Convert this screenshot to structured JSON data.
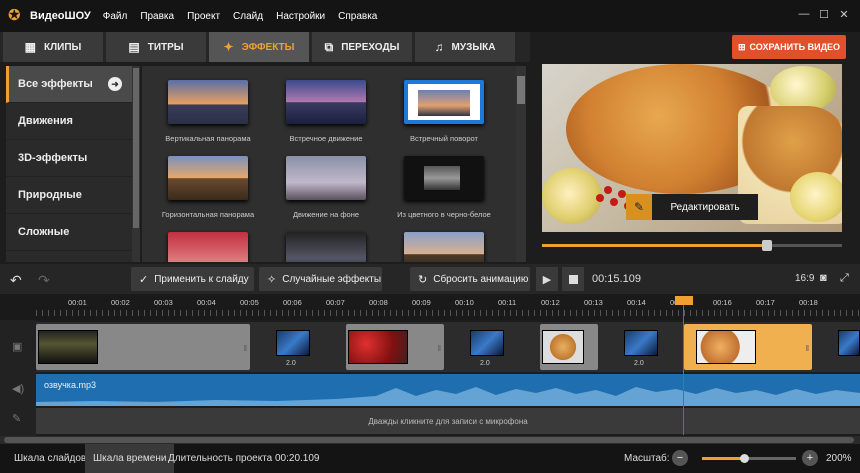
{
  "app": {
    "title": "ВидеоШОУ"
  },
  "menu": [
    "Файл",
    "Правка",
    "Проект",
    "Слайд",
    "Настройки",
    "Справка"
  ],
  "window_controls": [
    "—",
    "☐",
    "✕"
  ],
  "tabs": [
    {
      "label": "КЛИПЫ",
      "icon": "film-icon",
      "glyph": "▦"
    },
    {
      "label": "ТИТРЫ",
      "icon": "titles-icon",
      "glyph": "▤"
    },
    {
      "label": "ЭФФЕКТЫ",
      "icon": "effects-icon",
      "glyph": "✦",
      "active": true
    },
    {
      "label": "ПЕРЕХОДЫ",
      "icon": "transitions-icon",
      "glyph": "⧉"
    },
    {
      "label": "МУЗЫКА",
      "icon": "music-icon",
      "glyph": "♫"
    }
  ],
  "save_button": {
    "label": "СОХРАНИТЬ ВИДЕО",
    "glyph": "⊞"
  },
  "categories": [
    {
      "label": "Все эффекты",
      "active": true
    },
    {
      "label": "Движения"
    },
    {
      "label": "3D-эффекты"
    },
    {
      "label": "Природные"
    },
    {
      "label": "Сложные"
    }
  ],
  "effects": [
    {
      "label": "Вертикальная панорама"
    },
    {
      "label": "Встречное движение"
    },
    {
      "label": "Встречный поворот"
    },
    {
      "label": "Горизонтальная панорама"
    },
    {
      "label": "Движение на фоне"
    },
    {
      "label": "Из цветного в черно-белое"
    },
    {
      "label": ""
    },
    {
      "label": ""
    },
    {
      "label": ""
    }
  ],
  "preview": {
    "edit_label": "Редактировать",
    "seek_fraction": 0.75
  },
  "toolbar": {
    "apply": "Применить к слайду",
    "random": "Случайные эффекты",
    "reset": "Сбросить анимацию",
    "time": "00:15.109",
    "ratio": "16:9"
  },
  "ruler": [
    "00:01",
    "00:02",
    "00:03",
    "00:04",
    "00:05",
    "00:06",
    "00:07",
    "00:08",
    "00:09",
    "00:10",
    "00:11",
    "00:12",
    "00:13",
    "00:14",
    "00:15",
    "00:16",
    "00:17",
    "00:18"
  ],
  "transitions": [
    "2.0",
    "2.0",
    "2.0"
  ],
  "audio": {
    "name": "озвучка.mp3"
  },
  "mic_hint": "Дважды кликните для записи с микрофона",
  "status": {
    "slides_tab": "Шкала слайдов",
    "timeline_tab": "Шкала времени",
    "duration": "Длительность проекта 00:20.109",
    "scale_label": "Масштаб:",
    "zoom": "200%"
  }
}
